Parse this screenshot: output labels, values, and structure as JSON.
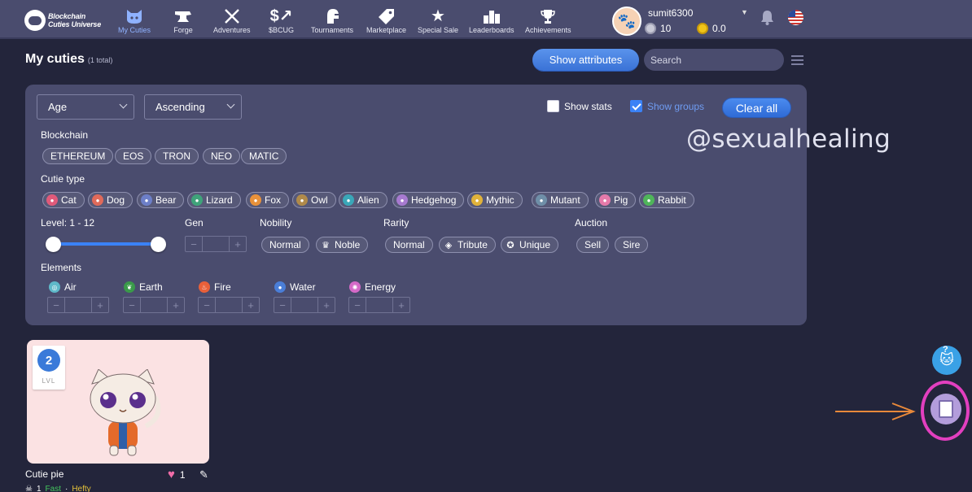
{
  "nav": {
    "logo_line1": "Blockchain",
    "logo_line2": "Cuties Universe",
    "items": [
      {
        "label": "My Cuties",
        "icon": "cat-face-icon"
      },
      {
        "label": "Forge",
        "icon": "anvil-icon"
      },
      {
        "label": "Adventures",
        "icon": "crossed-swords-icon"
      },
      {
        "label": "$BCUG",
        "icon": "bcug-token-icon"
      },
      {
        "label": "Tournaments",
        "icon": "helmet-icon"
      },
      {
        "label": "Marketplace",
        "icon": "price-tag-icon"
      },
      {
        "label": "Special Sale",
        "icon": "star-icon"
      },
      {
        "label": "Leaderboards",
        "icon": "podium-icon"
      },
      {
        "label": "Achievements",
        "icon": "trophy-icon"
      }
    ],
    "user": {
      "name": "sumit6300",
      "silver": "10",
      "gold": "0.0"
    }
  },
  "header": {
    "title": "My cuties",
    "count": "(1 total)",
    "show_attributes": "Show attributes",
    "search_placeholder": "Search"
  },
  "filters": {
    "sort_field": "Age",
    "sort_order": "Ascending",
    "show_stats": "Show stats",
    "show_groups": "Show groups",
    "clear_all": "Clear all",
    "blockchain_label": "Blockchain",
    "blockchains": [
      "ETHEREUM",
      "EOS",
      "TRON",
      "NEO",
      "MATIC"
    ],
    "cutie_type_label": "Cutie type",
    "cutie_types": [
      {
        "label": "Cat",
        "color": "#e05a7a"
      },
      {
        "label": "Dog",
        "color": "#e06a5a"
      },
      {
        "label": "Bear",
        "color": "#6d7fc8"
      },
      {
        "label": "Lizard",
        "color": "#3fa37a"
      },
      {
        "label": "Fox",
        "color": "#e8913a"
      },
      {
        "label": "Owl",
        "color": "#b08a4a"
      },
      {
        "label": "Alien",
        "color": "#3aa7b8"
      },
      {
        "label": "Hedgehog",
        "color": "#a77ad0"
      },
      {
        "label": "Mythic",
        "color": "#e0b23a"
      },
      {
        "label": "Mutant",
        "color": "#6f8fa8"
      },
      {
        "label": "Pig",
        "color": "#e57aaa"
      },
      {
        "label": "Rabbit",
        "color": "#4fb55a"
      }
    ],
    "level_label": "Level: 1 - 12",
    "gen_label": "Gen",
    "nobility_label": "Nobility",
    "nobility": [
      "Normal",
      "Noble"
    ],
    "rarity_label": "Rarity",
    "rarity": [
      "Normal",
      "Tribute",
      "Unique"
    ],
    "auction_label": "Auction",
    "auction": [
      "Sell",
      "Sire"
    ],
    "elements_label": "Elements",
    "elements": [
      {
        "label": "Air",
        "color": "#5fb9c9"
      },
      {
        "label": "Earth",
        "color": "#3a9a4a"
      },
      {
        "label": "Fire",
        "color": "#e8603a"
      },
      {
        "label": "Water",
        "color": "#4a7ed8"
      },
      {
        "label": "Energy",
        "color": "#d56ac8"
      }
    ]
  },
  "watermark": "@sexualhealing",
  "cutie": {
    "level": "2",
    "level_text": "LVL",
    "name": "Cutie pie",
    "likes": "1",
    "traits_count": "1",
    "trait1": "Fast",
    "trait2": "Hefty"
  }
}
